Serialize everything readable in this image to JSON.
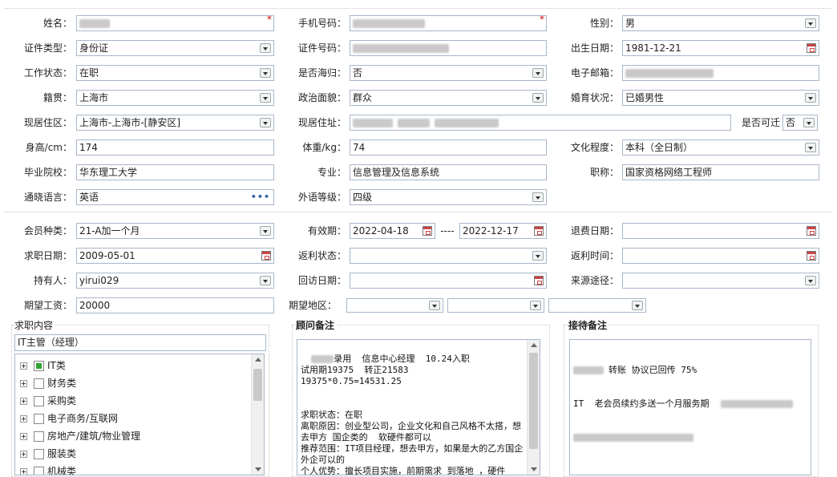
{
  "colors": {
    "required": "#d40000",
    "border": "#a9b7c9",
    "partial_check": "#2fa52f"
  },
  "basic": {
    "name_label": "姓名：",
    "name_required": "*",
    "phone_label": "手机号码：",
    "phone_required": "*",
    "gender_label": "性别：",
    "gender_value": "男",
    "idtype_label": "证件类型：",
    "idtype_value": "身份证",
    "idno_label": "证件号码：",
    "birth_label": "出生日期：",
    "birth_value": "1981-12-21",
    "workstatus_label": "工作状态：",
    "workstatus_value": "在职",
    "returnee_label": "是否海归：",
    "returnee_value": "否",
    "email_label": "电子邮箱：",
    "native_label": "籍贯：",
    "native_value": "上海市",
    "political_label": "政治面貌：",
    "political_value": "群众",
    "marital_label": "婚育状况：",
    "marital_value": "已婚男性",
    "residence_area_label": "现居住区：",
    "residence_area_value": "上海市-上海市-[静安区]",
    "residence_addr_label": "现居住址：",
    "relocate_label": "是否可迁",
    "relocate_value": "否",
    "height_label": "身高/cm：",
    "height_value": "174",
    "weight_label": "体重/kg：",
    "weight_value": "74",
    "education_label": "文化程度：",
    "education_value": "本科（全日制）",
    "school_label": "毕业院校：",
    "school_value": "华东理工大学",
    "major_label": "专业：",
    "major_value": "信息管理及信息系统",
    "title_label": "职称：",
    "title_value": "国家资格网络工程师",
    "language_label": "通晓语言：",
    "language_value": "英语",
    "language_more": "•••",
    "langlevel_label": "外语等级：",
    "langlevel_value": "四级"
  },
  "membership": {
    "type_label": "会员种类：",
    "type_value": "21-A加一个月",
    "valid_label": "有效期：",
    "valid_from": "2022-04-18",
    "valid_sep": "----",
    "valid_to": "2022-12-17",
    "refund_date_label": "退费日期：",
    "apply_date_label": "求职日期：",
    "apply_date_value": "2009-05-01",
    "rebate_status_label": "返利状态：",
    "rebate_time_label": "返利时间：",
    "holder_label": "持有人：",
    "holder_value": "yirui029",
    "visit_date_label": "回访日期：",
    "source_label": "来源途径：",
    "salary_label": "期望工资：",
    "salary_value": "20000",
    "region_label": "期望地区："
  },
  "job": {
    "title": "求职内容",
    "selected": "IT主管（经理）",
    "tree": [
      {
        "label": "IT类",
        "state": "partial"
      },
      {
        "label": "财务类",
        "state": "unchecked"
      },
      {
        "label": "采购类",
        "state": "unchecked"
      },
      {
        "label": "电子商务/互联网",
        "state": "unchecked"
      },
      {
        "label": "房地产/建筑/物业管理",
        "state": "unchecked"
      },
      {
        "label": "服装类",
        "state": "unchecked"
      },
      {
        "label": "机械类",
        "state": "unchecked"
      }
    ]
  },
  "advisor_notes": {
    "title": "顾问备注",
    "text": "录用  信息中心经理  10.24入职\n试用期19375  转正21583\n19375*0.75=14531.25\n\n\n求职状态：在职\n离职原因：创业型公司，企业文化和自己风格不太搭，想去甲方 国企类的  软硬件都可以\n推荐范围：IT项目经理，想去甲方，如果是大的乙方国企外企可以的\n个人优势：擅长项目实施，前期需求 到落地 ，硬件"
  },
  "reception_notes": {
    "title": "接待备注",
    "line1": "转账 协议已回传 75%",
    "line2": "IT  老会员续约多送一个月服务期"
  }
}
